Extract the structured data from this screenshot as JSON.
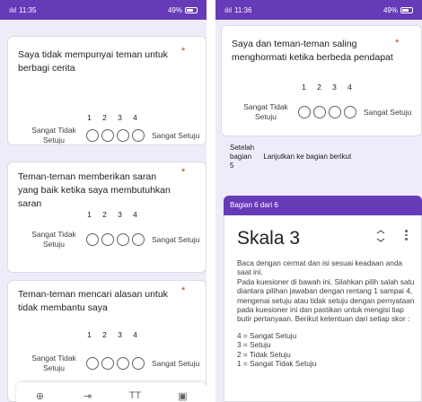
{
  "left_screen": {
    "status": {
      "time": "11:35",
      "signal": "ılıl",
      "battery": "49%"
    },
    "questions": [
      {
        "text": "Saya tidak mempunyai teman untuk berbagi cerita",
        "required": "*",
        "scale_numbers": [
          "1",
          "2",
          "3",
          "4"
        ],
        "low_label": "Sangat Tidak Setuju",
        "high_label": "Sangat Setuju"
      },
      {
        "text": "Teman-teman memberikan saran yang baik ketika saya membutuhkan saran",
        "required": "*",
        "scale_numbers": [
          "1",
          "2",
          "3",
          "4"
        ],
        "low_label": "Sangat Tidak Setuju",
        "high_label": "Sangat Setuju"
      },
      {
        "text": "Teman-teman mencari alasan untuk tidak membantu saya",
        "required": "*",
        "scale_numbers": [
          "1",
          "2",
          "3",
          "4"
        ],
        "low_label": "Sangat Tidak Setuju",
        "high_label": "Sangat Setuju"
      }
    ],
    "toolbar": [
      {
        "icon": "add-circle-icon",
        "glyph": "⊕"
      },
      {
        "icon": "import-icon",
        "glyph": "⇥"
      },
      {
        "icon": "title-icon",
        "glyph": "TT"
      },
      {
        "icon": "image-icon",
        "glyph": "▣"
      }
    ]
  },
  "right_screen": {
    "status": {
      "time": "11:36",
      "signal": "ılıl",
      "battery": "49%"
    },
    "question": {
      "text": "Saya dan teman-teman saling menghormati ketika berbeda pendapat",
      "required": "*",
      "scale_numbers": [
        "1",
        "2",
        "3",
        "4"
      ],
      "low_label": "Sangat Tidak Setuju",
      "high_label": "Sangat Setuju"
    },
    "after_section": {
      "label_line1": "Setelah",
      "label_line2": "bagian",
      "label_line3": "5",
      "value": "Lanjutkan ke bagian berikut"
    },
    "section": {
      "header": "Bagian 6 dari 6",
      "title": "Skala 3",
      "description_lines": [
        "Baca dengan cermat dan isi sesuai keadaan anda saat ini.",
        "Pada kuesioner di bawah ini, Silahkan pilih salah satu diantara pilihan jawaban dengan rentang 1 sampai 4, mengenai setuju atau tidak setuju dengan pernyataan pada kuesioner ini dan pastikan untuk mengisi tiap butir pertanyaan. Berikut ketentuan dari setiap skor :",
        "",
        "4 = Sangat Setuju",
        "3 = Setuju",
        "2 = Tidak Setuju",
        "1 = Sangat Tidak Setuju"
      ]
    }
  },
  "colors": {
    "accent": "#673ab7",
    "background": "#f0ebf8",
    "required": "#d93025"
  }
}
